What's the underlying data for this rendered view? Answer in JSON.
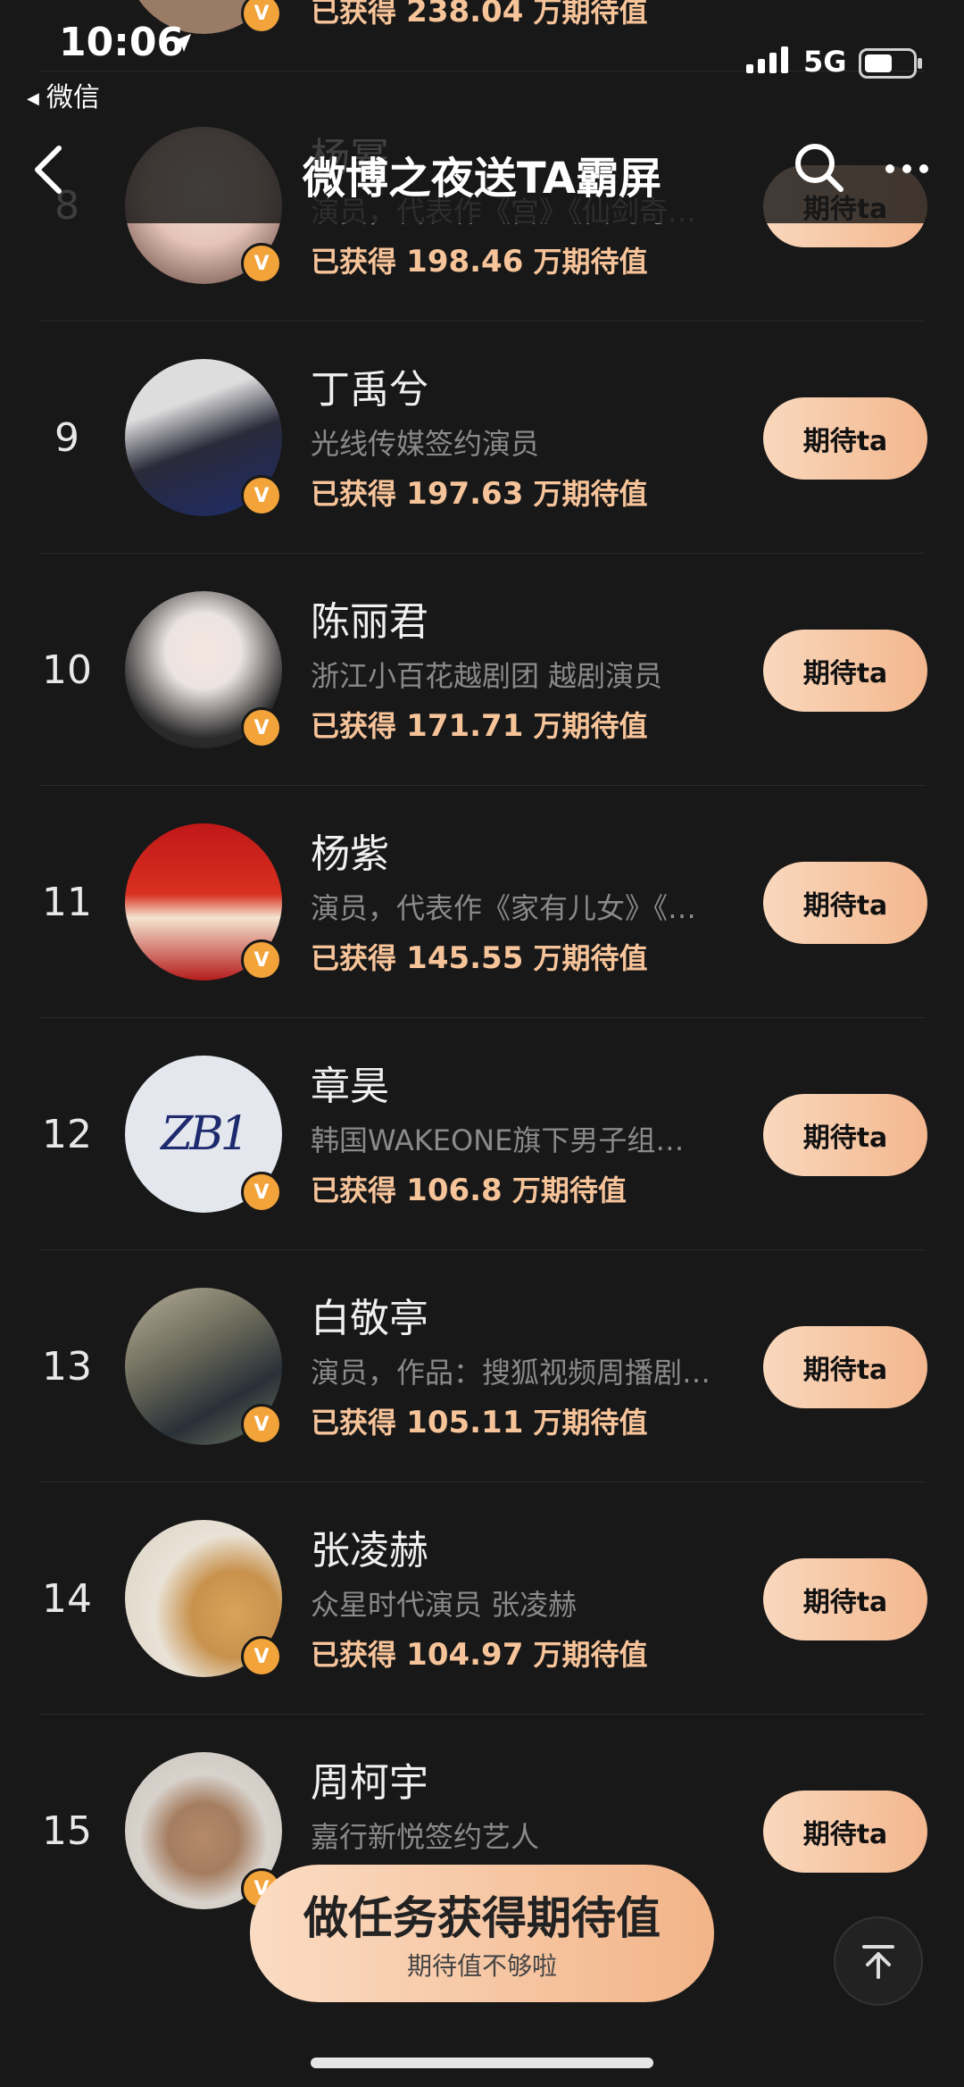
{
  "status_bar": {
    "time": "10:06",
    "back_label": "微信",
    "network": "5G"
  },
  "nav": {
    "title": "微博之夜送TA霸屏"
  },
  "rows": [
    {
      "rank": "",
      "name": "",
      "desc": "",
      "score_prefix": "已获得",
      "score_value": "238.04",
      "score_suffix": "万期待值",
      "button": ""
    },
    {
      "rank": "8",
      "name": "杨幂",
      "desc": "演员，代表作《宫》《仙剑奇…",
      "score_prefix": "已获得",
      "score_value": "198.46",
      "score_suffix": "万期待值",
      "button": "期待ta"
    },
    {
      "rank": "9",
      "name": "丁禹兮",
      "desc": "光线传媒签约演员",
      "score_prefix": "已获得",
      "score_value": "197.63",
      "score_suffix": "万期待值",
      "button": "期待ta"
    },
    {
      "rank": "10",
      "name": "陈丽君",
      "desc": "浙江小百花越剧团 越剧演员",
      "score_prefix": "已获得",
      "score_value": "171.71",
      "score_suffix": "万期待值",
      "button": "期待ta"
    },
    {
      "rank": "11",
      "name": "杨紫",
      "desc": "演员，代表作《家有儿女》《…",
      "score_prefix": "已获得",
      "score_value": "145.55",
      "score_suffix": "万期待值",
      "button": "期待ta"
    },
    {
      "rank": "12",
      "name": "章昊",
      "desc": "韩国WAKEONE旗下男子组…",
      "score_prefix": "已获得",
      "score_value": "106.8",
      "score_suffix": "万期待值",
      "button": "期待ta"
    },
    {
      "rank": "13",
      "name": "白敬亭",
      "desc": "演员，作品：搜狐视频周播剧…",
      "score_prefix": "已获得",
      "score_value": "105.11",
      "score_suffix": "万期待值",
      "button": "期待ta"
    },
    {
      "rank": "14",
      "name": "张凌赫",
      "desc": "众星时代演员 张凌赫",
      "score_prefix": "已获得",
      "score_value": "104.97",
      "score_suffix": "万期待值",
      "button": "期待ta"
    },
    {
      "rank": "15",
      "name": "周柯宇",
      "desc": "嘉行新悦签约艺人",
      "score_prefix": "",
      "score_value": "",
      "score_suffix": "",
      "button": "期待ta"
    }
  ],
  "cta": {
    "main": "做任务获得期待值",
    "sub": "期待值不够啦"
  },
  "avatar_badge": "V",
  "avatar_logo_text": "ZB1",
  "colors": {
    "background": "#181818",
    "accent": "#f7c49a",
    "button": "#f3b78e",
    "badge": "#f2a33a"
  }
}
